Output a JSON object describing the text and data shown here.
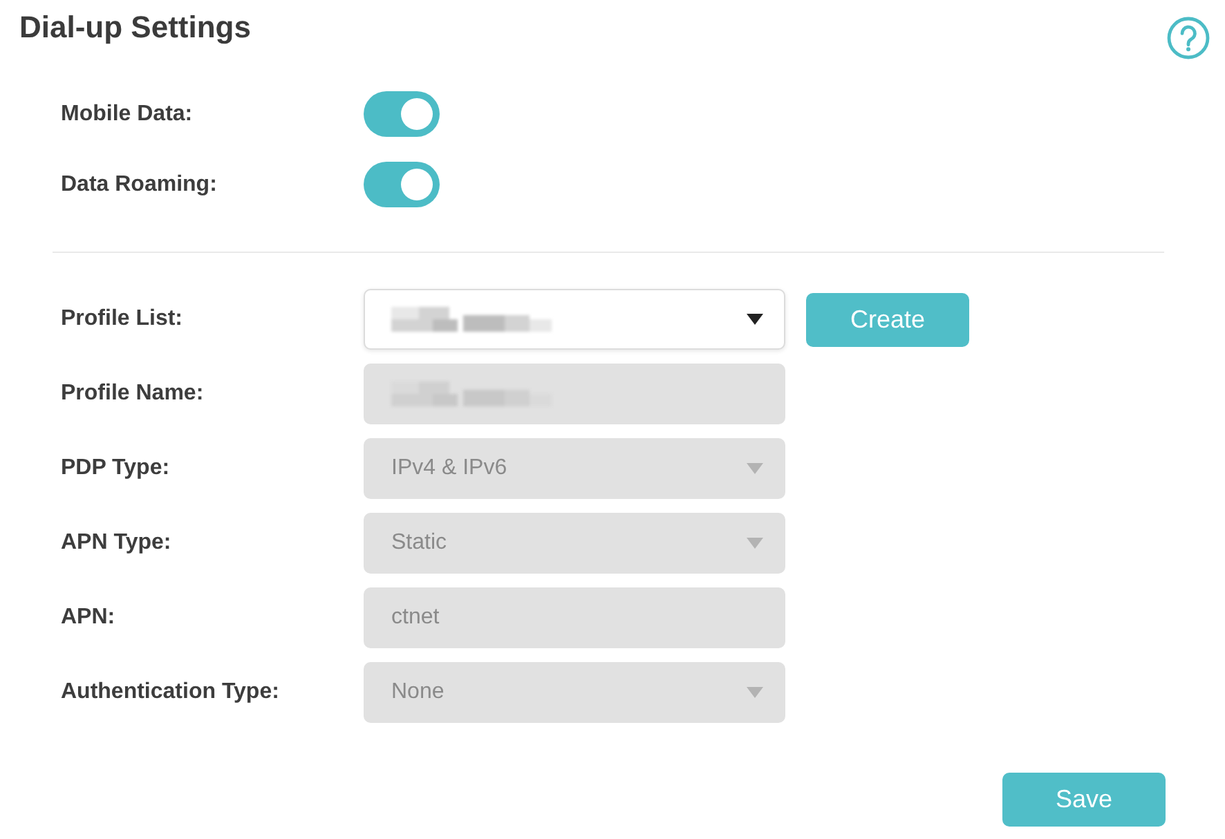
{
  "title": "Dial-up Settings",
  "toggles": [
    {
      "label": "Mobile Data:",
      "on": true
    },
    {
      "label": "Data Roaming:",
      "on": true
    }
  ],
  "fields": [
    {
      "label": "Profile List:",
      "kind": "select",
      "disabled": false,
      "blurred": true,
      "button": "Create"
    },
    {
      "label": "Profile Name:",
      "kind": "text",
      "disabled": true,
      "blurred": true
    },
    {
      "label": "PDP Type:",
      "kind": "select",
      "disabled": true,
      "value": "IPv4 & IPv6"
    },
    {
      "label": "APN Type:",
      "kind": "select",
      "disabled": true,
      "value": "Static"
    },
    {
      "label": "APN:",
      "kind": "text",
      "disabled": true,
      "value": "ctnet"
    },
    {
      "label": "Authentication Type:",
      "kind": "select",
      "disabled": true,
      "value": "None"
    }
  ],
  "save_button": "Save"
}
